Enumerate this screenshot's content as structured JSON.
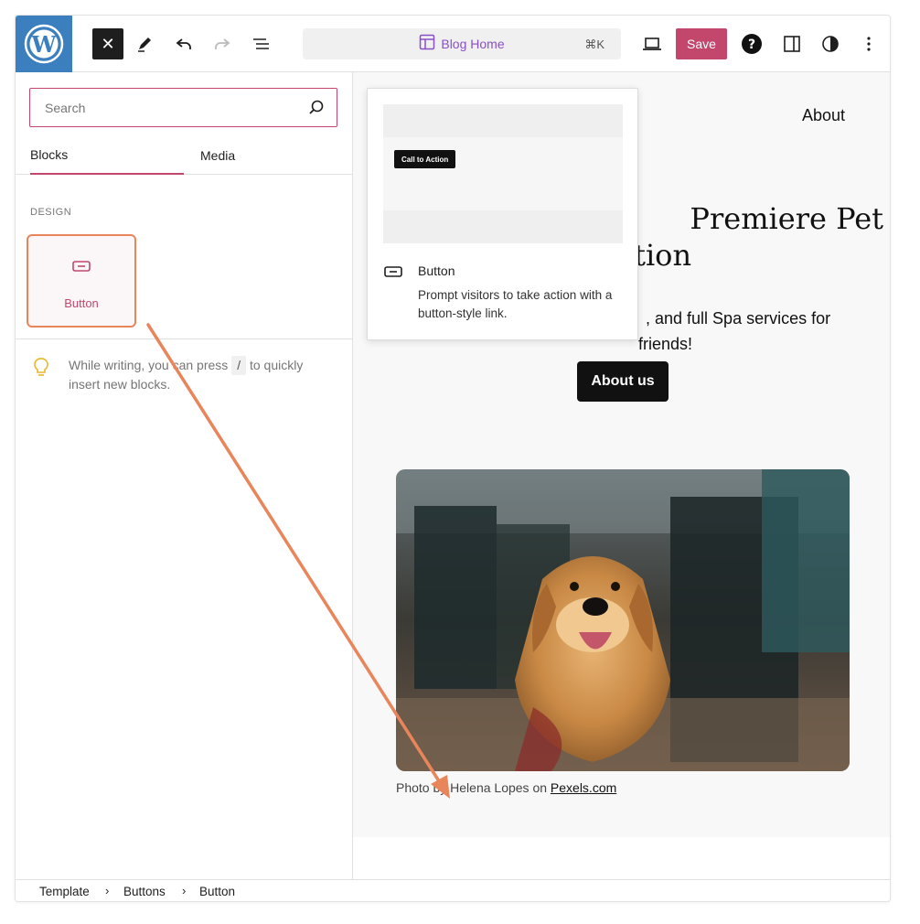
{
  "toolbar": {
    "close_label": "✕",
    "document_title": "Blog Home",
    "shortcut": "⌘K",
    "save_label": "Save"
  },
  "inserter": {
    "search_placeholder": "Search",
    "tabs": [
      {
        "label": "Blocks",
        "active": true
      },
      {
        "label": "Media",
        "active": false
      }
    ],
    "section_label": "DESIGN",
    "blocks": [
      {
        "label": "Button",
        "icon": "button-block-icon"
      }
    ],
    "tip": {
      "before": "While writing, you can press",
      "key": "/",
      "after": "to quickly insert new blocks."
    }
  },
  "preview": {
    "sample_button": "Call to Action",
    "title": "Button",
    "description": "Prompt visitors to take action with a button-style link."
  },
  "canvas": {
    "nav_link": "About",
    "title_line1": "Premiere Pet",
    "title_line2": "ation",
    "subtitle_line1": ", and full Spa services for",
    "subtitle_line2": "friends!",
    "button_label": "About us",
    "caption_prefix": "Photo by Helena Lopes on",
    "caption_link": "Pexels.com"
  },
  "breadcrumb": [
    "Template",
    "Buttons",
    "Button"
  ],
  "colors": {
    "accent": "#c3466d",
    "wp_logo_bg": "#3b7fbf",
    "drag_arrow": "#e9855b",
    "title_link": "#8a4fc7"
  }
}
